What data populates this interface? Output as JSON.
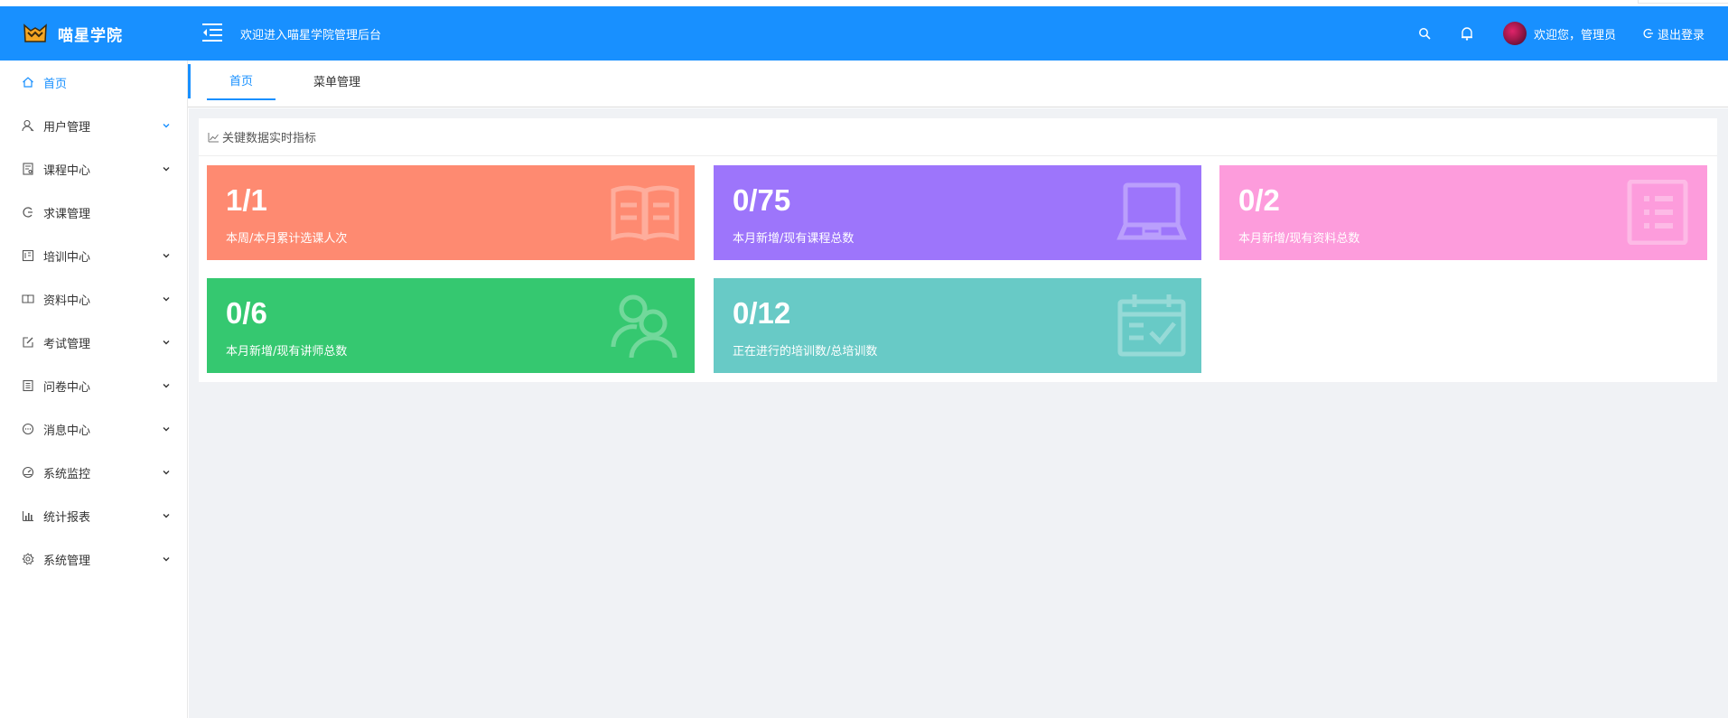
{
  "brand": {
    "name": "喵星学院"
  },
  "header": {
    "welcome": "欢迎进入喵星学院管理后台",
    "user_greeting": "欢迎您，管理员",
    "logout_label": "退出登录"
  },
  "sidebar": {
    "items": [
      {
        "label": "首页",
        "icon": "home-icon",
        "active": true,
        "expandable": false
      },
      {
        "label": "用户管理",
        "icon": "user-icon",
        "active": false,
        "expandable": true
      },
      {
        "label": "课程中心",
        "icon": "course-icon",
        "active": false,
        "expandable": true
      },
      {
        "label": "求课管理",
        "icon": "request-icon",
        "active": false,
        "expandable": false
      },
      {
        "label": "培训中心",
        "icon": "training-icon",
        "active": false,
        "expandable": true
      },
      {
        "label": "资料中心",
        "icon": "book-icon",
        "active": false,
        "expandable": true
      },
      {
        "label": "考试管理",
        "icon": "edit-icon",
        "active": false,
        "expandable": true
      },
      {
        "label": "问卷中心",
        "icon": "survey-icon",
        "active": false,
        "expandable": true
      },
      {
        "label": "消息中心",
        "icon": "message-icon",
        "active": false,
        "expandable": true
      },
      {
        "label": "系统监控",
        "icon": "dashboard-icon",
        "active": false,
        "expandable": true
      },
      {
        "label": "统计报表",
        "icon": "bar-chart-icon",
        "active": false,
        "expandable": true
      },
      {
        "label": "系统管理",
        "icon": "gear-icon",
        "active": false,
        "expandable": true
      }
    ]
  },
  "tabs": [
    {
      "label": "首页",
      "active": true
    },
    {
      "label": "菜单管理",
      "active": false
    }
  ],
  "panel": {
    "title": "关键数据实时指标"
  },
  "cards": [
    {
      "value": "1/1",
      "label": "本周/本月累计选课人次",
      "color": "#fe8a71",
      "icon": "open-book-icon"
    },
    {
      "value": "0/75",
      "label": "本月新增/现有课程总数",
      "color": "#9d75fb",
      "icon": "laptop-icon"
    },
    {
      "value": "0/2",
      "label": "本月新增/现有资料总数",
      "color": "#fd9cdc",
      "icon": "list-doc-icon"
    },
    {
      "value": "0/6",
      "label": "本月新增/现有讲师总数",
      "color": "#35c870",
      "icon": "users-icon"
    },
    {
      "value": "0/12",
      "label": "正在进行的培训数/总培训数",
      "color": "#68cac6",
      "icon": "calendar-check-icon"
    }
  ],
  "colors": {
    "primary": "#1890ff",
    "content_bg": "#f0f2f5"
  }
}
